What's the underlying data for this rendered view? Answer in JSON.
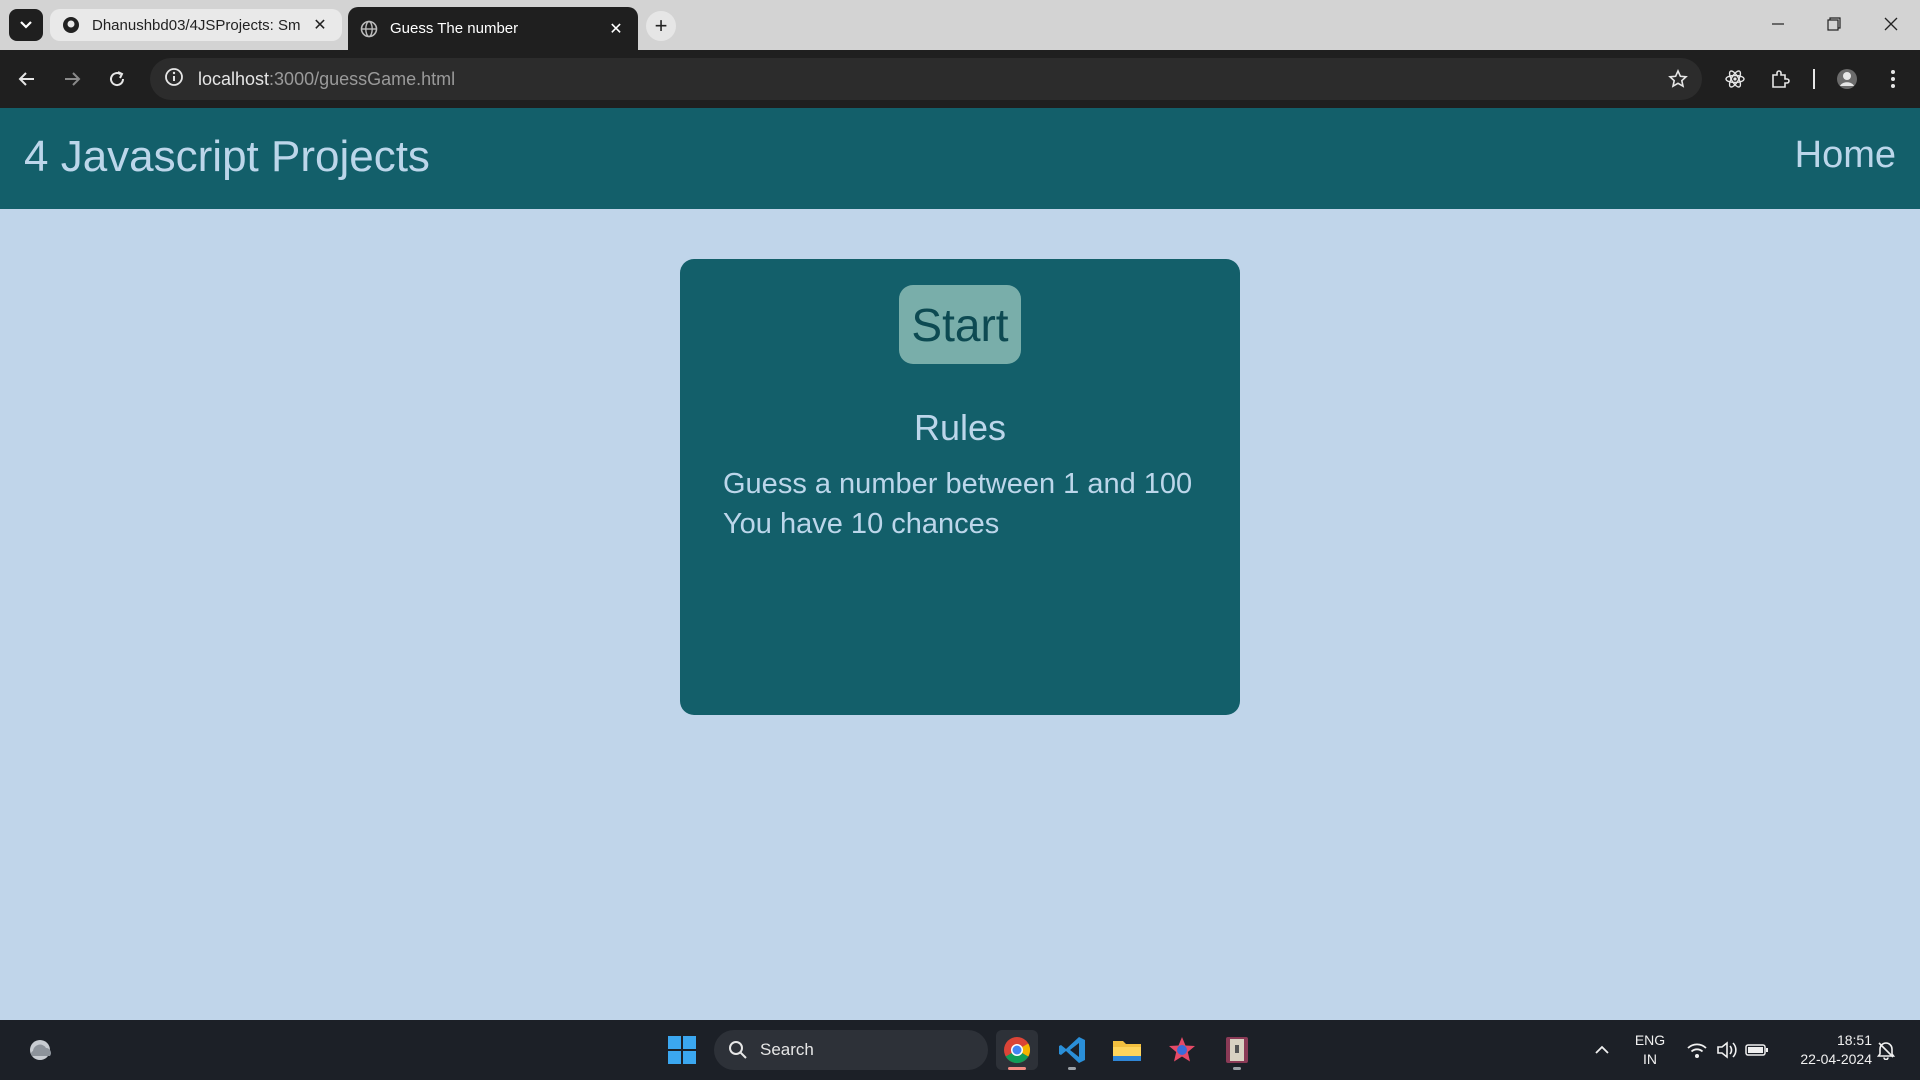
{
  "browser": {
    "tabs": [
      {
        "title": "Dhanushbd03/4JSProjects: Sm",
        "active": false
      },
      {
        "title": "Guess The number",
        "active": true
      }
    ],
    "url_host": "localhost",
    "url_path": ":3000/guessGame.html"
  },
  "page": {
    "brand": "4 Javascript Projects",
    "nav_home": "Home",
    "game": {
      "start_label": "Start",
      "rules_title": "Rules",
      "rules": [
        "Guess a number between 1 and 100",
        "You have 10 chances"
      ]
    }
  },
  "taskbar": {
    "search_label": "Search",
    "lang_line1": "ENG",
    "lang_line2": "IN",
    "time": "18:51",
    "date": "22-04-2024"
  },
  "colors": {
    "page_background": "#c0d5ea",
    "navbar": "#135f6a",
    "card": "#135f6a",
    "start_button": "#79aeaa",
    "text_light": "#bcd6ea"
  }
}
